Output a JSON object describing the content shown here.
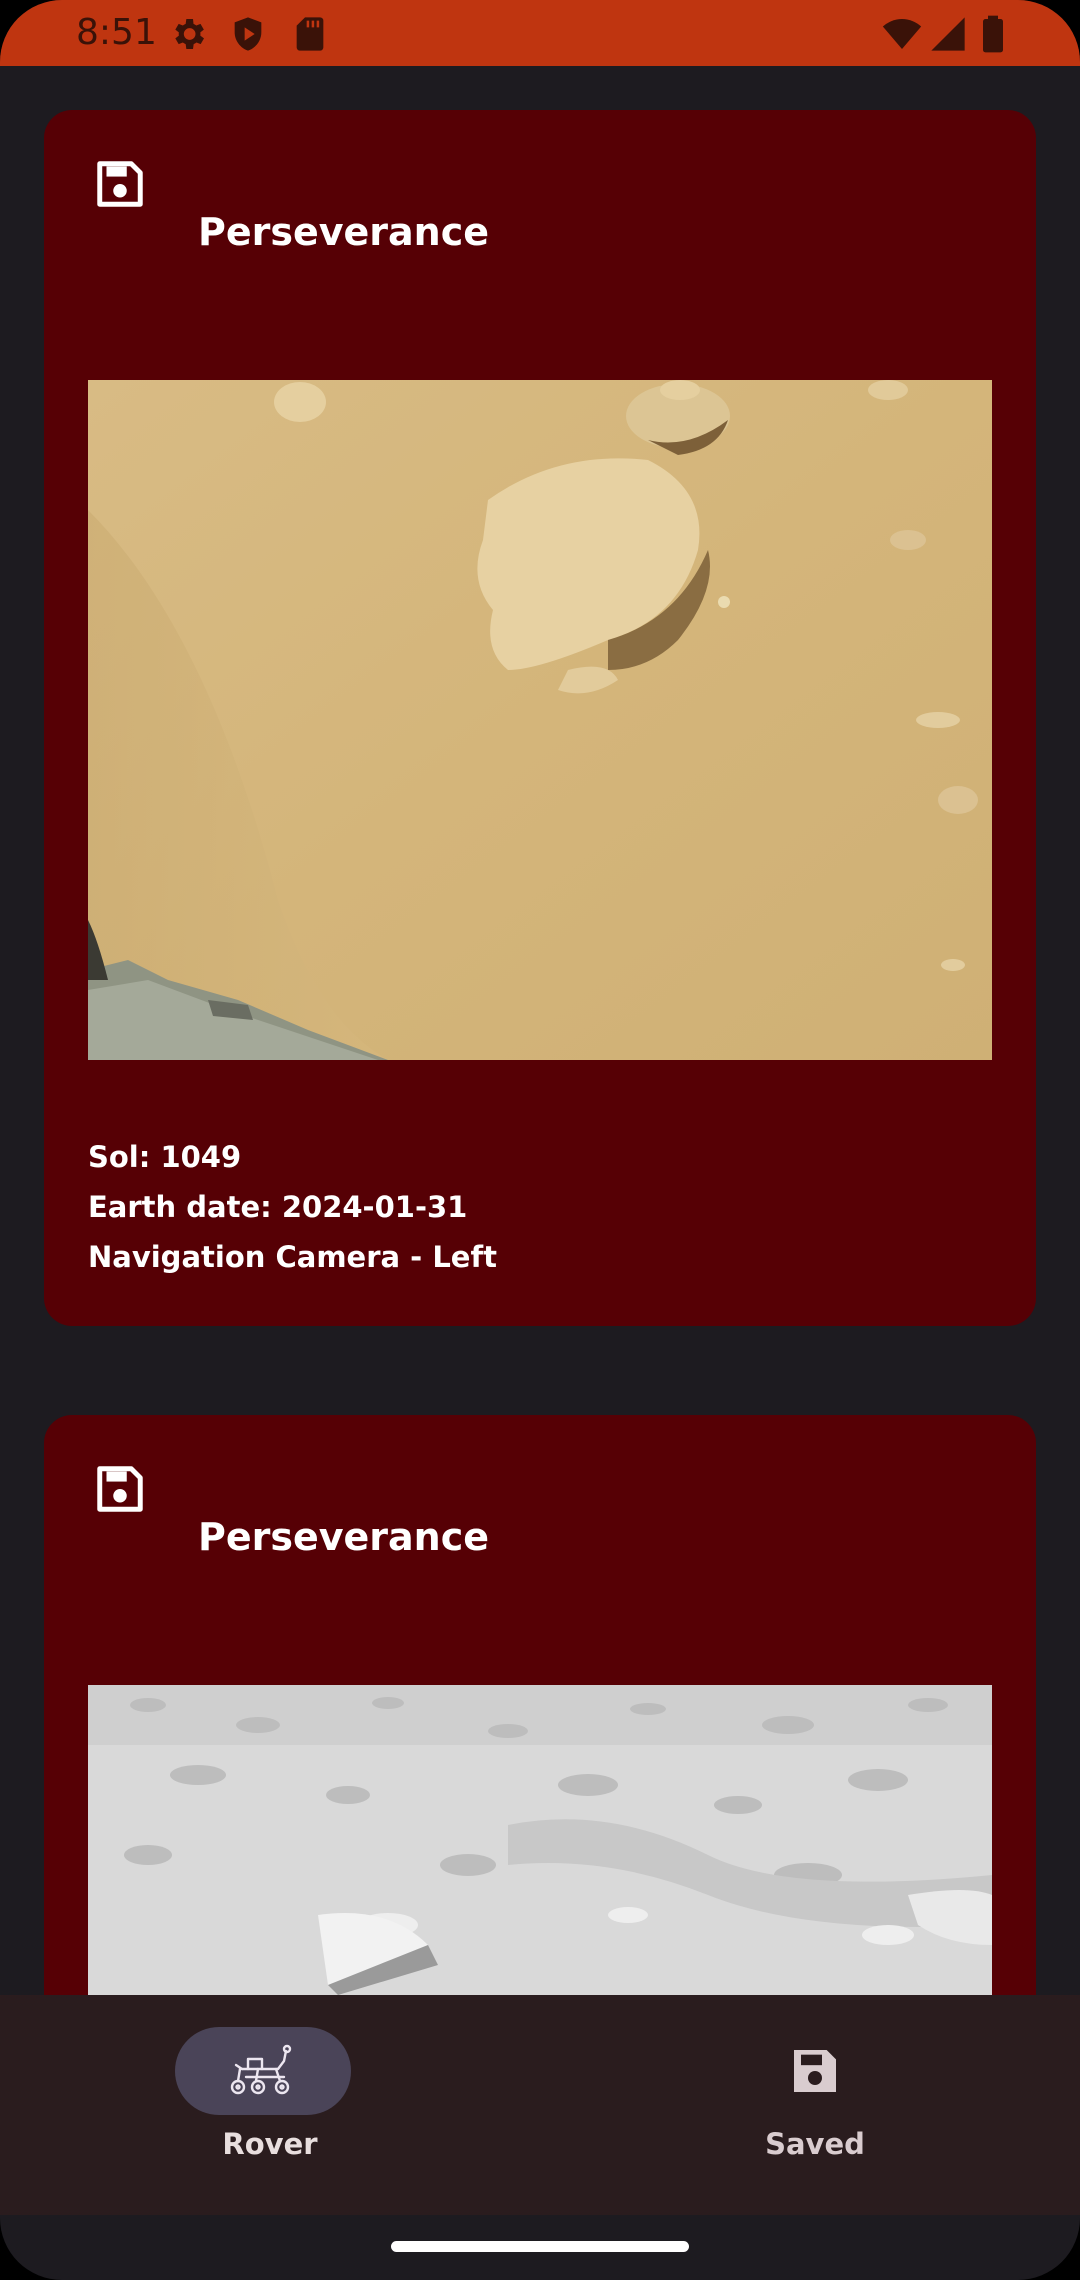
{
  "status_bar": {
    "time": "8:51",
    "icons_left": [
      "gear-icon",
      "shield-play-icon",
      "sd-card-icon"
    ],
    "icons_right": [
      "wifi-icon",
      "signal-icon",
      "battery-icon"
    ],
    "color": "#bf3510"
  },
  "cards": [
    {
      "title": "Perseverance",
      "sol": "Sol: 1049",
      "earth_date": "Earth date: 2024-01-31",
      "camera": "Navigation Camera - Left",
      "save_icon": "floppy-disk-icon"
    },
    {
      "title": "Perseverance",
      "save_icon": "floppy-disk-icon"
    }
  ],
  "bottom_nav": {
    "items": [
      {
        "label": "Rover",
        "icon": "rover-icon",
        "selected": true
      },
      {
        "label": "Saved",
        "icon": "floppy-disk-icon",
        "selected": false
      }
    ]
  },
  "colors": {
    "card_background": "#560005",
    "page_background": "#1d1b20",
    "nav_background": "#2a1c1e",
    "nav_selected_pill": "#4a4458"
  }
}
